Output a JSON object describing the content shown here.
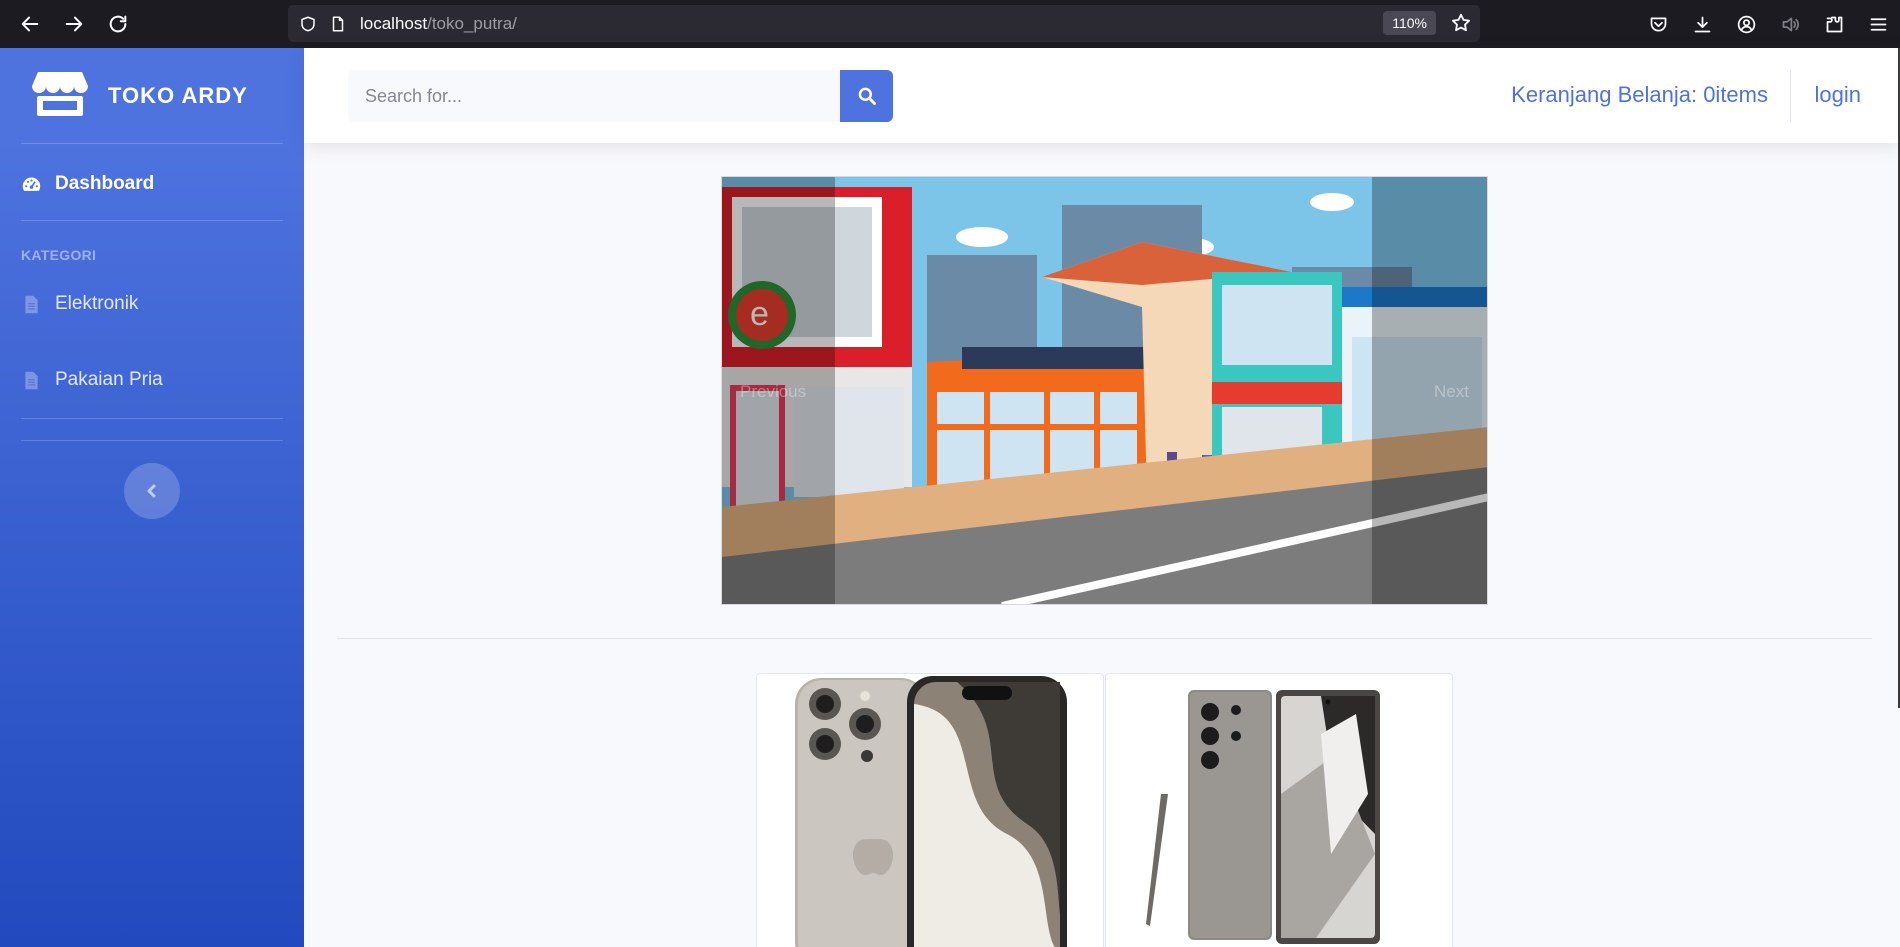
{
  "browser": {
    "url_host": "localhost",
    "url_path": "/toko_putra/",
    "zoom": "110%"
  },
  "sidebar": {
    "brand": "TOKO ARDY",
    "dashboard_label": "Dashboard",
    "section_heading": "KATEGORI",
    "items": [
      {
        "label": "Elektronik"
      },
      {
        "label": "Pakaian Pria"
      }
    ]
  },
  "topbar": {
    "search_placeholder": "Search for...",
    "cart_label": "Keranjang Belanja: 0items",
    "login_label": "login"
  },
  "carousel": {
    "prev_label": "Previous",
    "next_label": "Next"
  },
  "colors": {
    "primary": "#4e73df",
    "sidebar_bottom": "#224abe",
    "page_bg": "#f8f9fc"
  }
}
